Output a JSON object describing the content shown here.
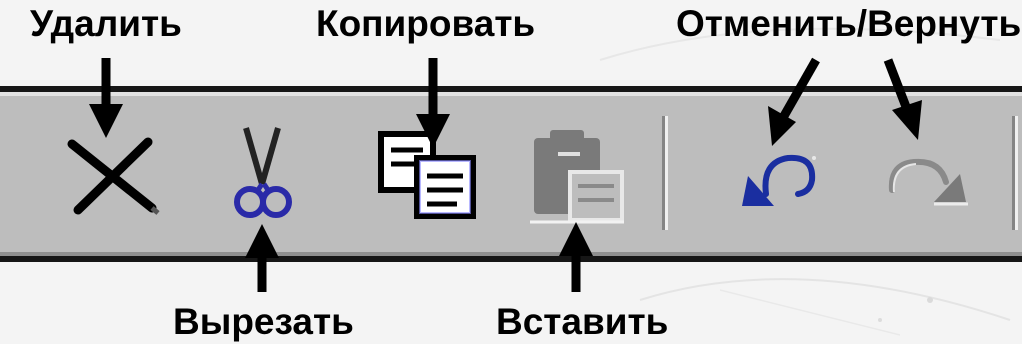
{
  "labels": {
    "delete": "Удалить",
    "copy": "Копировать",
    "undo_redo": "Отменить/Вернуть",
    "cut": "Вырезать",
    "paste": "Вставить"
  },
  "toolbar": {
    "buttons": [
      {
        "id": "delete",
        "icon": "delete-x-icon"
      },
      {
        "id": "cut",
        "icon": "scissors-icon"
      },
      {
        "id": "copy",
        "icon": "copy-icon"
      },
      {
        "id": "paste",
        "icon": "paste-icon",
        "state": "disabled"
      },
      {
        "id": "undo",
        "icon": "undo-icon"
      },
      {
        "id": "redo",
        "icon": "redo-icon",
        "state": "disabled"
      }
    ]
  },
  "colors": {
    "toolbar_bg": "#bdbdbd",
    "label_text": "#000000",
    "undo_blue": "#1a2ea0",
    "scissors_blue": "#2a2aa8",
    "disabled_gray": "#7a7a7a"
  }
}
